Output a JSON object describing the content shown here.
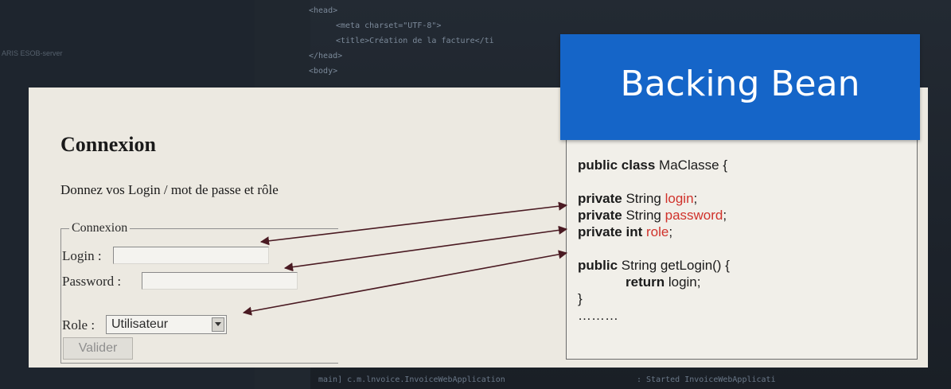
{
  "editor": {
    "code_lines": [
      "<head>",
      "<meta charset=\"UTF-8\">",
      "<title>Création de la facture</ti",
      "</head>",
      "<body>"
    ],
    "sidebar_text": "ARIS ESOB-server",
    "footer_left": "main] c.m.lnvoice.InvoiceWebApplication",
    "footer_right": ": Started InvoiceWebApplicati"
  },
  "login_page": {
    "title": "Connexion",
    "description": "Donnez vos Login / mot de passe et rôle",
    "fieldset_legend": "Connexion",
    "login_label": "Login :",
    "login_value": "",
    "password_label": "Password :",
    "password_value": "",
    "role_label": "Role :",
    "role_selected": "Utilisateur",
    "submit_label": "Valider"
  },
  "backing_bean": {
    "header": "Backing Bean",
    "lines": {
      "class_kw": "public class",
      "class_name": " MaClasse  {",
      "l1_kw": "private",
      "l1_type": " String ",
      "l1_name": "login",
      "l1_end": ";",
      "l2_kw": "private",
      "l2_type": " String ",
      "l2_name": "password",
      "l2_end": ";",
      "l3_kw": "private int",
      "l3_name": " role",
      "l3_end": ";",
      "m_kw": "public",
      "m_sig": " String getLogin() {",
      "ret_kw": "return",
      "ret_val": " login;",
      "close": "}",
      "ellipsis": "………"
    }
  },
  "colors": {
    "header_blue": "#1565c8",
    "field_name_red": "#d0322b",
    "arrow": "#4a1a22"
  }
}
